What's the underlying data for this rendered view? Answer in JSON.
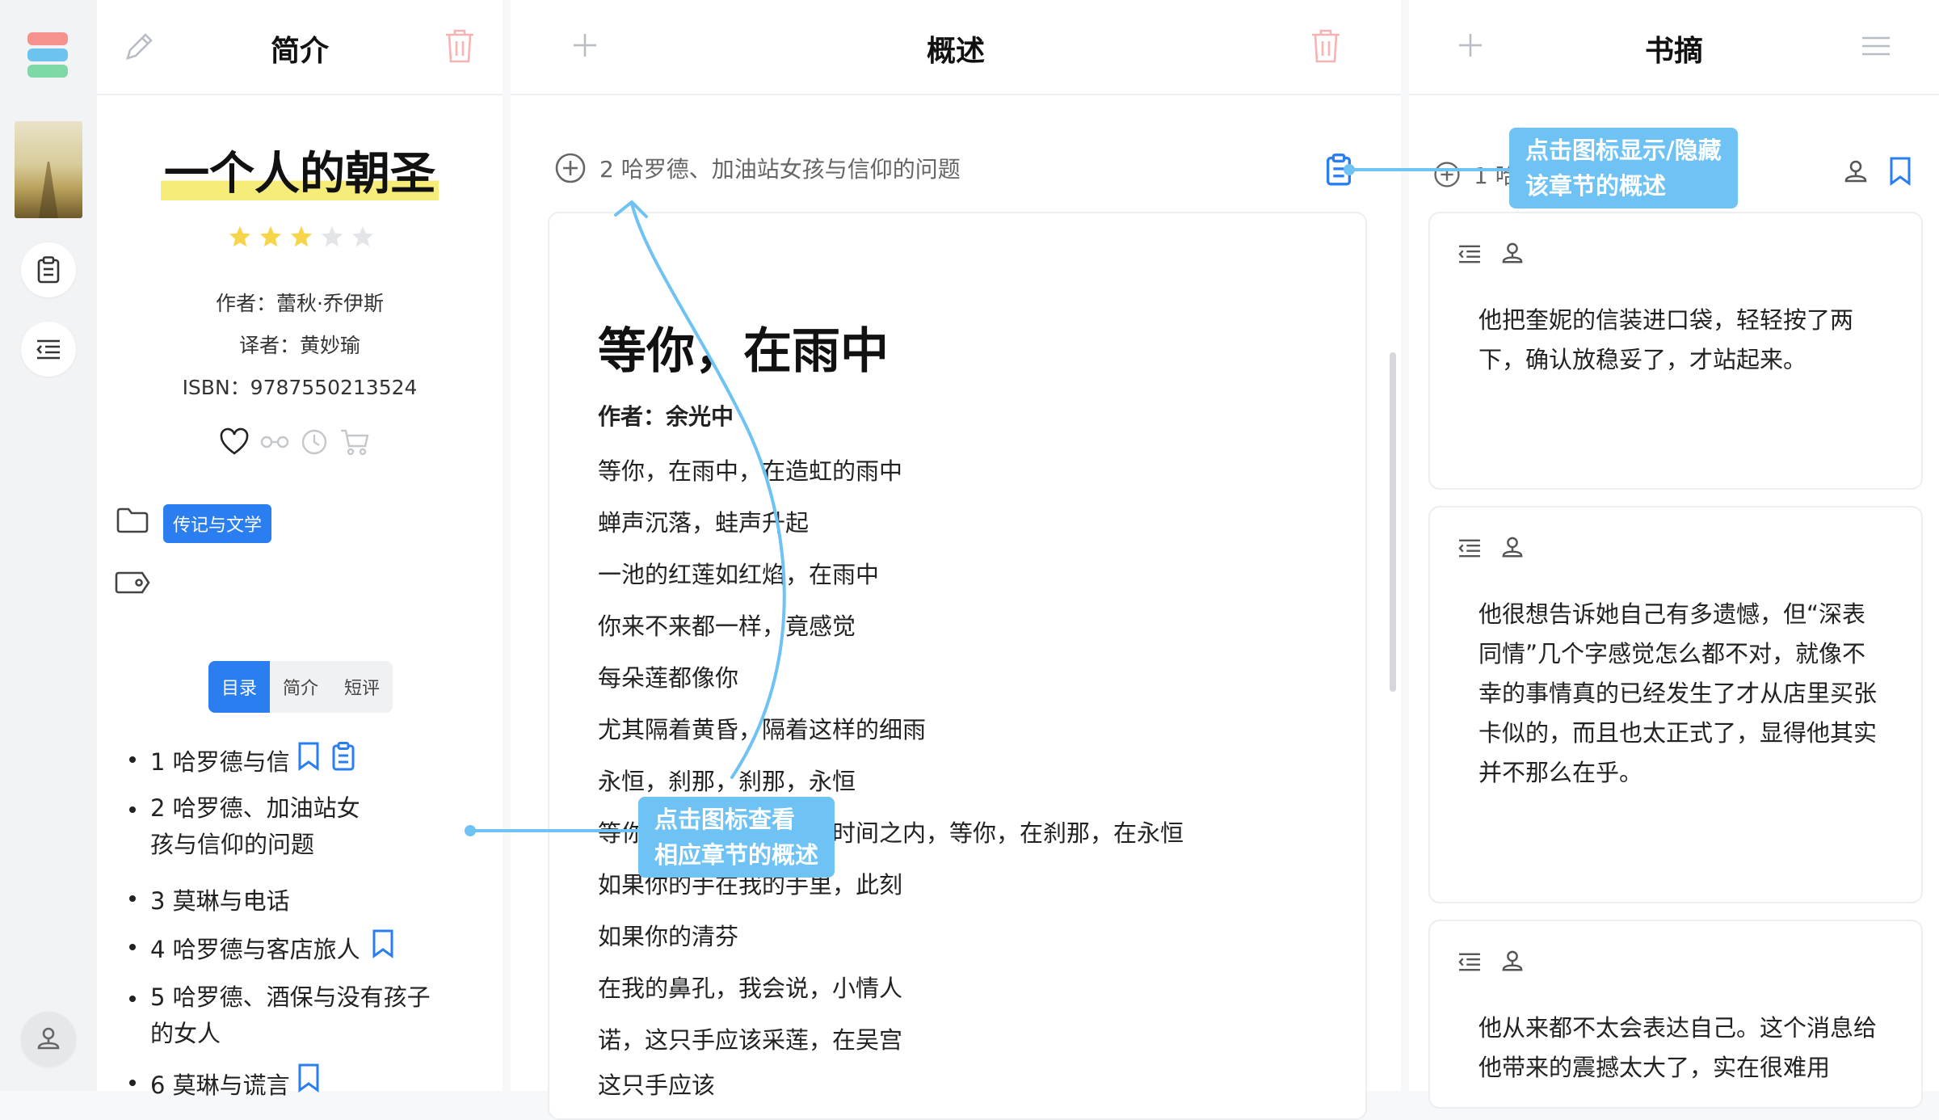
{
  "app": {
    "logo_colors": [
      "#f5928e",
      "#6cc3f0",
      "#7ed9a8"
    ],
    "accent": "#2a7ef0",
    "callout_color": "#6ec2f4"
  },
  "intro": {
    "header_title": "简介",
    "book_title": "一个人的朝圣",
    "rating": 3,
    "rating_max": 5,
    "author": "作者：蕾秋·乔伊斯",
    "translator": "译者：黄妙瑜",
    "isbn": "ISBN：9787550213524",
    "category_tag": "传记与文学",
    "tabs": [
      "目录",
      "简介",
      "短评"
    ],
    "active_tab": "目录",
    "toc": [
      {
        "label": "1 哈罗德与信"
      },
      {
        "label": "2 哈罗德、加油站女孩与信仰的问题"
      },
      {
        "label": "3 莫琳与电话"
      },
      {
        "label": "4 哈罗德与客店旅人"
      },
      {
        "label": "5 哈罗德、酒保与没有孩子的女人"
      },
      {
        "label": "6 莫琳与谎言"
      }
    ]
  },
  "summary": {
    "header_title": "概述",
    "chapter_label": "2 哈罗德、加油站女孩与信仰的问题",
    "poem_title": "等你，在雨中",
    "poem_author": "作者：余光中",
    "poem_lines": [
      "等你，在雨中，在造虹的雨中",
      "蝉声沉落，蛙声升起",
      "一池的红莲如红焰，在雨中",
      "你来不来都一样，竟感觉",
      "每朵莲都像你",
      "尤其隔着黄昏，隔着这样的细雨",
      "永恒，刹那，刹那，永恒",
      "等你，在时间之外，在时间之内，等你，在刹那，在永恒",
      "如果你的手在我的手里，此刻",
      "如果你的清芬",
      "在我的鼻孔，我会说，小情人",
      "诺，这只手应该采莲，在吴宫",
      "这只手应该"
    ]
  },
  "notes": {
    "header_title": "书摘",
    "chapter_label": "1 哈罗德与信",
    "items": [
      {
        "text": "他把奎妮的信装进口袋，轻轻按了两下，确认放稳妥了，才站起来。"
      },
      {
        "text": "他很想告诉她自己有多遗憾，但“深表同情”几个字感觉怎么都不对，就像不幸的事情真的已经发生了才从店里买张卡似的，而且也太正式了，显得他其实并不那么在乎。"
      },
      {
        "text": "他从来都不太会表达自己。这个消息给他带来的震撼太大了，实在很难用"
      }
    ]
  },
  "callouts": {
    "toggle_summary": "点击图标显示/隐藏\n该章节的概述",
    "view_summary": "点击图标查看\n相应章节的概述"
  }
}
